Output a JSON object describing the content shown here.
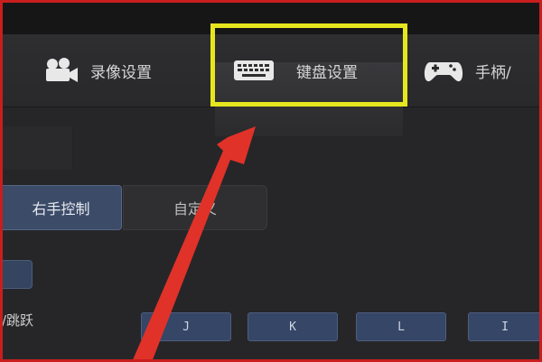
{
  "tabs": [
    {
      "label": "录像设置",
      "icon": "camera-icon"
    },
    {
      "label": "键盘设置",
      "icon": "keyboard-icon"
    },
    {
      "label": "手柄/",
      "icon": "gamepad-icon"
    }
  ],
  "control_mode": {
    "right_hand": "右手控制",
    "custom": "自定义"
  },
  "keymap_row": {
    "label": "/跳跃",
    "keys": [
      "J",
      "K",
      "L",
      "I"
    ]
  },
  "colors": {
    "highlight_border": "#e6e61e",
    "arrow": "#e03228",
    "frame": "#c81e1e",
    "key_bg": "#354667"
  }
}
